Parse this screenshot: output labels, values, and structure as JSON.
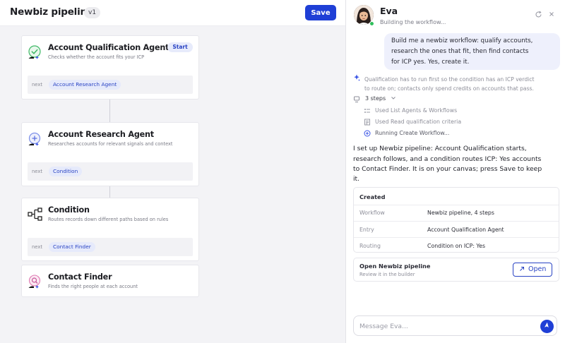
{
  "builder": {
    "title": "Newbiz pipeline",
    "version": "v1",
    "save_label": "Save",
    "next_label": "next",
    "start_badge": "Start",
    "nodes": [
      {
        "title": "Account Qualification Agent",
        "description": "Checks whether the account fits your ICP",
        "next": "Account Research Agent",
        "icon": "check-circle-icon"
      },
      {
        "title": "Account Research Agent",
        "description": "Researches accounts for relevant signals and context",
        "next": "Condition",
        "icon": "plus-circle-icon"
      },
      {
        "title": "Condition",
        "description": "Routes records down different paths based on rules",
        "next": "Contact Finder",
        "icon": "branch-icon"
      },
      {
        "title": "Contact Finder",
        "description": "Finds the right people at each account",
        "icon": "search-person-icon"
      }
    ]
  },
  "chat": {
    "agent_name": "Eva",
    "agent_status": "Building the workflow...",
    "user_message_lines": [
      "Build me a newbiz workflow: qualify accounts,",
      "research the ones that fit, then find contacts",
      "for ICP yes. Yes, create it."
    ],
    "reasoning_lines": [
      "Qualification has to run first so the condition has an ICP verdict",
      "to route on; contacts only spend credits on accounts that pass."
    ],
    "steps_label": "3 steps",
    "steps": [
      {
        "label": "Used List Agents & Workflows",
        "icon": "list-icon",
        "state": "done"
      },
      {
        "label": "Used Read qualification criteria",
        "icon": "doc-icon",
        "state": "done"
      },
      {
        "label": "Running Create Workflow...",
        "icon": "plus-circle-icon",
        "state": "running"
      }
    ],
    "reply_lines": [
      "I set up Newbiz pipeline: Account Qualification starts,",
      "research follows, and a condition routes ICP: Yes accounts",
      "to Contact Finder. It is on your canvas; press Save to keep",
      "it."
    ],
    "created_card": {
      "title": "Created",
      "rows": [
        {
          "key": "Workflow",
          "value": "Newbiz pipeline, 4 steps"
        },
        {
          "key": "Entry",
          "value": "Account Qualification Agent"
        },
        {
          "key": "Routing",
          "value": "Condition on ICP: Yes"
        }
      ]
    },
    "open_card": {
      "title": "Open Newbiz pipeline",
      "subtitle": "Review it in the builder",
      "button_label": "Open"
    },
    "composer_placeholder": "Message Eva..."
  },
  "colors": {
    "accent": "#1f3fd6",
    "chip_bg": "#e6eafb",
    "online": "#2fbf5b"
  }
}
